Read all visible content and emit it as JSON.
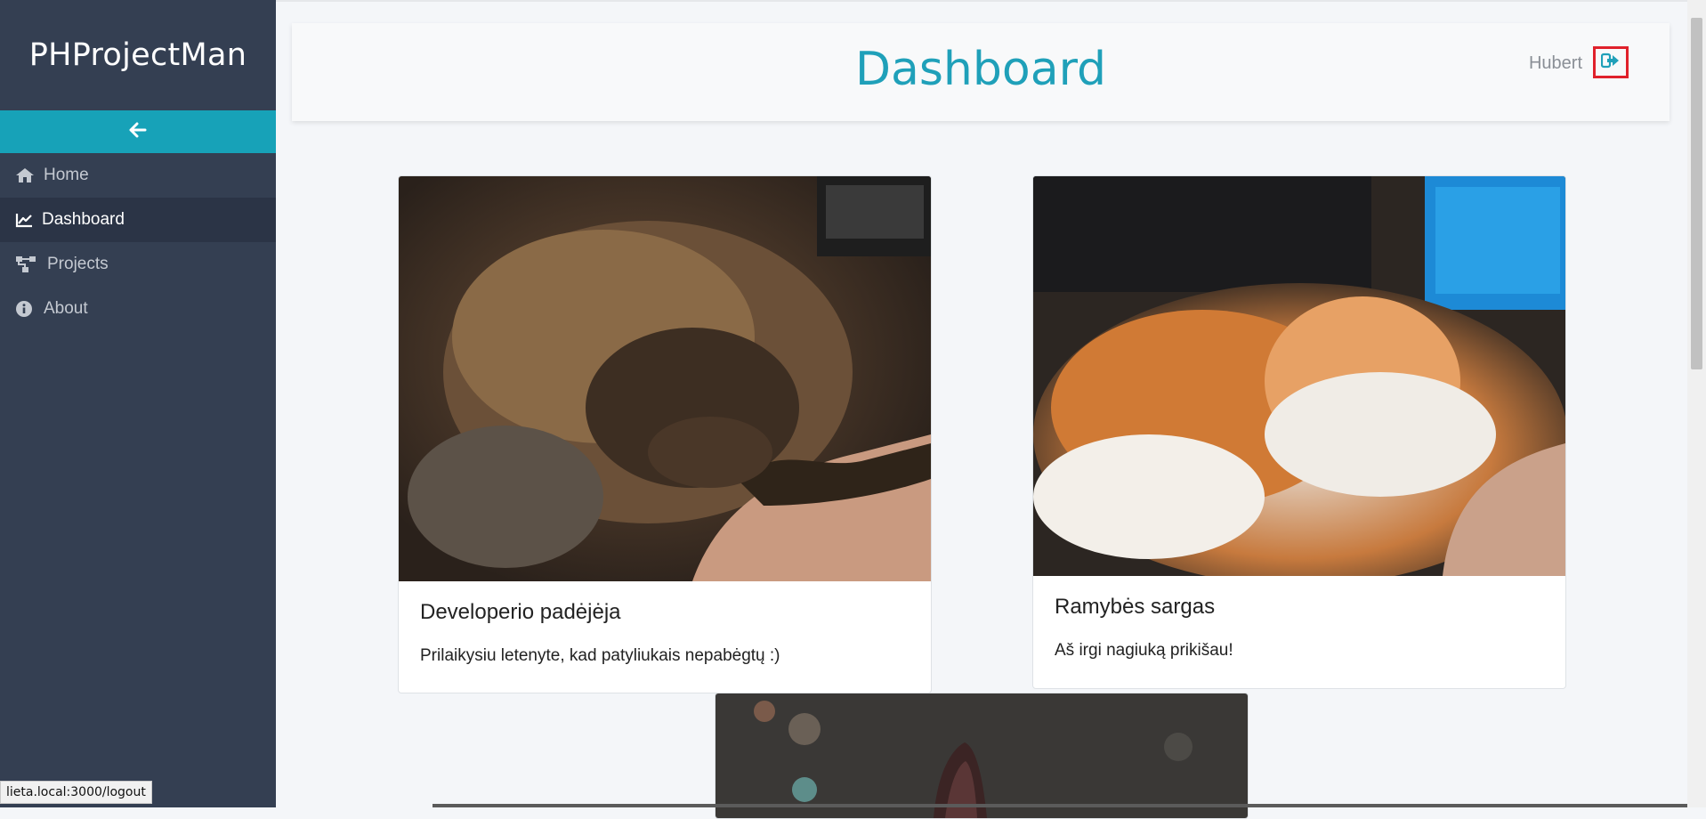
{
  "brand": "PHProjectMan",
  "sidebar": {
    "collapse_icon": "arrow-left-icon",
    "items": [
      {
        "label": "Home",
        "icon": "home-icon",
        "active": false
      },
      {
        "label": "Dashboard",
        "icon": "chart-line-icon",
        "active": true
      },
      {
        "label": "Projects",
        "icon": "sitemap-icon",
        "active": false
      },
      {
        "label": "About",
        "icon": "info-circle-icon",
        "active": false
      }
    ]
  },
  "header": {
    "title": "Dashboard",
    "user": "Hubert",
    "logout_icon": "sign-out-icon"
  },
  "cards": [
    {
      "title": "Developerio padėjėja",
      "text": "Prilaikysiu letenyte, kad patyliukais nepabėgtų :)",
      "image": "tortoiseshell-cat-photo"
    },
    {
      "title": "Ramybės sargas",
      "text": "Aš irgi nagiuką prikišau!",
      "image": "orange-white-cat-photo"
    },
    {
      "title": "",
      "text": "",
      "image": "cat-ear-photo"
    }
  ],
  "status_bar": {
    "url": "lieta.local:3000/logout"
  },
  "colors": {
    "sidebar_bg": "#343f52",
    "accent": "#17a2b8",
    "title": "#1fa0b9",
    "logout_highlight": "#e0212b"
  }
}
